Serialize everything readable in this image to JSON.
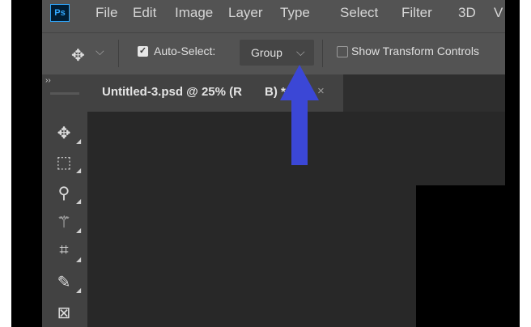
{
  "app": {
    "logo_text": "Ps"
  },
  "menubar": {
    "items": [
      "File",
      "Edit",
      "Image",
      "Layer",
      "Type",
      "Select",
      "Filter",
      "3D",
      "V"
    ]
  },
  "options_bar": {
    "move_icon": "move-icon",
    "auto_select_label": "Auto-Select:",
    "auto_select_checked": true,
    "target_value": "Group",
    "show_transform_label": "Show Transform Controls",
    "show_transform_checked": false
  },
  "toolbar": {
    "collapse_glyph": "››",
    "tools": [
      "move-tool",
      "rectangular-marquee-tool",
      "lasso-tool",
      "magic-wand-tool",
      "crop-tool",
      "eyedropper-tool",
      "frame-tool"
    ]
  },
  "document": {
    "tab_title": "Untitled-3.psd @ 25% (R",
    "tab_title_tail": "B) *",
    "close_glyph": "×"
  },
  "annotation": {
    "arrow_color": "#3b47d6"
  },
  "colors": {
    "app_bg": "#535353",
    "toolbar_bg": "#424242",
    "canvas_bg": "#282828",
    "accent_ps": "#31a8ff"
  }
}
